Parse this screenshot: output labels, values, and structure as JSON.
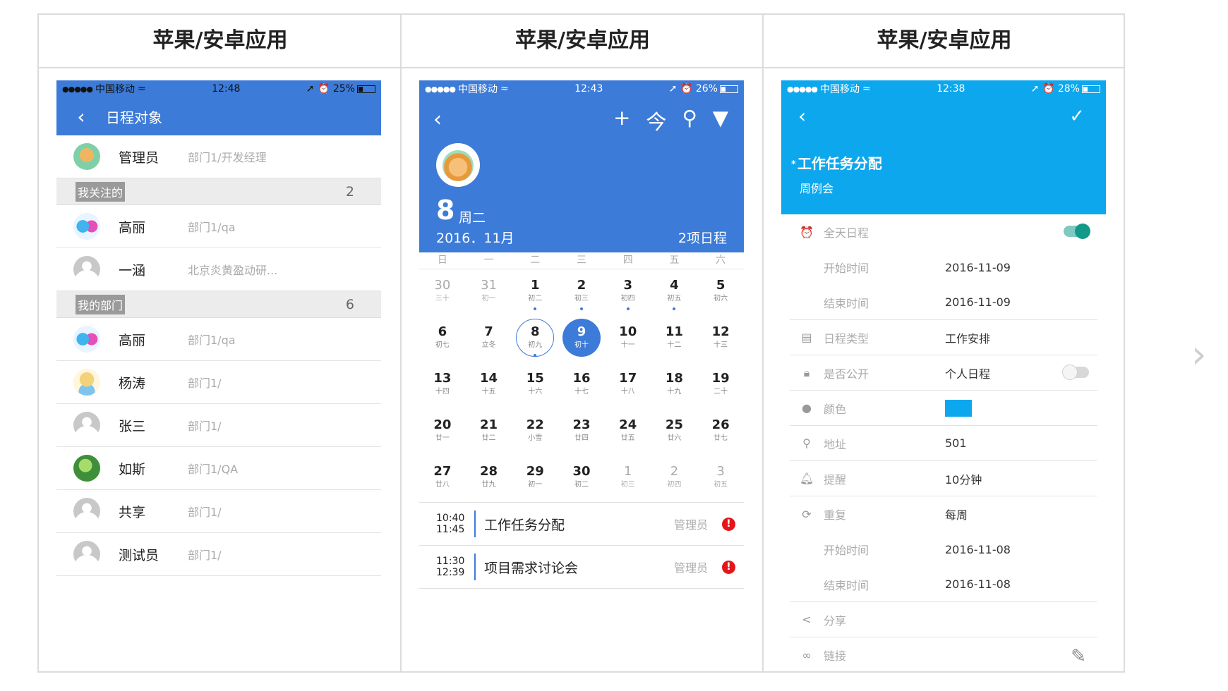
{
  "columns": [
    "苹果/安卓应用",
    "苹果/安卓应用",
    "苹果/安卓应用"
  ],
  "phone1": {
    "status": {
      "carrier": "中国移动",
      "time": "12:48",
      "battery": "25%",
      "battery_level": 0.25
    },
    "title": "日程对象",
    "admin": {
      "name": "管理员",
      "dept": "部门1/开发经理"
    },
    "section_follow": {
      "label": "我关注的",
      "count": "2"
    },
    "follow_items": [
      {
        "name": "高丽",
        "dept": "部门1/qa"
      },
      {
        "name": "一涵",
        "dept": "北京炎黄盈动研..."
      }
    ],
    "section_dept": {
      "label": "我的部门",
      "count": "6"
    },
    "dept_items": [
      {
        "name": "高丽",
        "dept": "部门1/qa"
      },
      {
        "name": "杨涛",
        "dept": "部门1/"
      },
      {
        "name": "张三",
        "dept": "部门1/"
      },
      {
        "name": "如斯",
        "dept": "部门1/QA"
      },
      {
        "name": "共享",
        "dept": "部门1/"
      },
      {
        "name": "测试员",
        "dept": "部门1/"
      }
    ]
  },
  "phone2": {
    "status": {
      "carrier": "中国移动",
      "time": "12:43",
      "battery": "26%",
      "battery_level": 0.26
    },
    "toolbar": {
      "today_label": "今"
    },
    "day": "8",
    "weekday": "周二",
    "month": "2016．11月",
    "schedule_count": "2项日程",
    "weekdays": [
      "日",
      "一",
      "二",
      "三",
      "四",
      "五",
      "六"
    ],
    "days": [
      {
        "d": "30",
        "l": "三十",
        "dim": true
      },
      {
        "d": "31",
        "l": "初一",
        "dim": true
      },
      {
        "d": "1",
        "l": "初二",
        "dot": true
      },
      {
        "d": "2",
        "l": "初三",
        "dot": true
      },
      {
        "d": "3",
        "l": "初四",
        "dot": true
      },
      {
        "d": "4",
        "l": "初五",
        "dot": true
      },
      {
        "d": "5",
        "l": "初六"
      },
      {
        "d": "6",
        "l": "初七"
      },
      {
        "d": "7",
        "l": "立冬"
      },
      {
        "d": "8",
        "l": "初九",
        "today": true,
        "dot": true
      },
      {
        "d": "9",
        "l": "初十",
        "sel": true
      },
      {
        "d": "10",
        "l": "十一"
      },
      {
        "d": "11",
        "l": "十二"
      },
      {
        "d": "12",
        "l": "十三"
      },
      {
        "d": "13",
        "l": "十四"
      },
      {
        "d": "14",
        "l": "十五"
      },
      {
        "d": "15",
        "l": "十六"
      },
      {
        "d": "16",
        "l": "十七"
      },
      {
        "d": "17",
        "l": "十八"
      },
      {
        "d": "18",
        "l": "十九"
      },
      {
        "d": "19",
        "l": "二十"
      },
      {
        "d": "20",
        "l": "廿一"
      },
      {
        "d": "21",
        "l": "廿二"
      },
      {
        "d": "22",
        "l": "小雪"
      },
      {
        "d": "23",
        "l": "廿四"
      },
      {
        "d": "24",
        "l": "廿五"
      },
      {
        "d": "25",
        "l": "廿六"
      },
      {
        "d": "26",
        "l": "廿七"
      },
      {
        "d": "27",
        "l": "廿八"
      },
      {
        "d": "28",
        "l": "廿九"
      },
      {
        "d": "29",
        "l": "初一"
      },
      {
        "d": "30",
        "l": "初二"
      },
      {
        "d": "1",
        "l": "初三",
        "dim": true
      },
      {
        "d": "2",
        "l": "初四",
        "dim": true
      },
      {
        "d": "3",
        "l": "初五",
        "dim": true
      }
    ],
    "events": [
      {
        "start": "10:40",
        "end": "11:45",
        "title": "工作任务分配",
        "owner": "管理员"
      },
      {
        "start": "11:30",
        "end": "12:39",
        "title": "项目需求讨论会",
        "owner": "管理员"
      }
    ]
  },
  "phone3": {
    "status": {
      "carrier": "中国移动",
      "time": "12:38",
      "battery": "28%",
      "battery_level": 0.28
    },
    "title": "工作任务分配",
    "subtitle": "周例会",
    "rows": {
      "allday": {
        "label": "全天日程",
        "on": true
      },
      "start1": {
        "label": "开始时间",
        "value": "2016-11-09"
      },
      "end1": {
        "label": "结束时间",
        "value": "2016-11-09"
      },
      "type": {
        "label": "日程类型",
        "value": "工作安排"
      },
      "public": {
        "label": "是否公开",
        "value": "个人日程",
        "on": false
      },
      "color": {
        "label": "颜色",
        "color": "#0da7ee"
      },
      "address": {
        "label": "地址",
        "value": "501"
      },
      "remind": {
        "label": "提醒",
        "value": "10分钟"
      },
      "repeat": {
        "label": "重复",
        "value": "每周"
      },
      "start2": {
        "label": "开始时间",
        "value": "2016-11-08"
      },
      "end2": {
        "label": "结束时间",
        "value": "2016-11-08"
      },
      "share": {
        "label": "分享"
      },
      "link": {
        "label": "链接"
      }
    }
  }
}
